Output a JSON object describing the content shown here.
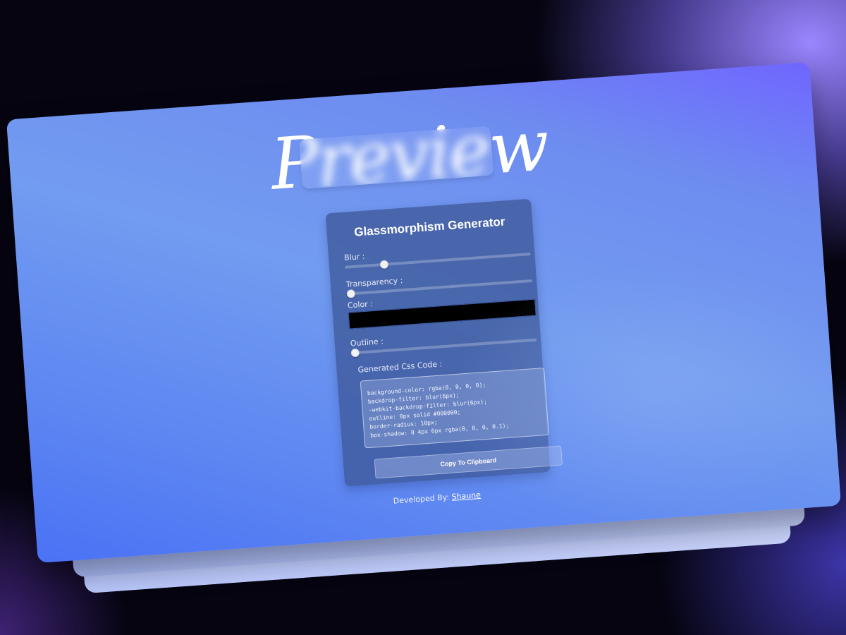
{
  "preview": {
    "text": "Preview"
  },
  "generator": {
    "title": "Glassmorphism Generator",
    "blur": {
      "label": "Blur :",
      "value_fraction": 0.21
    },
    "transparency": {
      "label": "Transparency :",
      "value_fraction": 0.0
    },
    "color": {
      "label": "Color :",
      "value": "#000000"
    },
    "outline": {
      "label": "Outline :",
      "value_fraction": 0.0
    },
    "code_label": "Generated Css Code :",
    "code_lines": [
      "background-color: rgba(0, 0, 0, 0);",
      "backdrop-filter: blur(6px);",
      "-webkit-backdrop-filter: blur(6px);",
      "outline: 0px solid #000000;",
      "border-radius: 10px;",
      "box-shadow: 0 4px 6px rgba(0, 0, 0, 0.1);"
    ],
    "copy_button": "Copy To Clipboard"
  },
  "footer": {
    "prefix": "Developed By:",
    "author": "Shaune"
  },
  "colors": {
    "card_gradient_start": "#6f66ff",
    "card_gradient_end": "#4a72f5",
    "panel_bg": "#3c5596",
    "background": "#050410"
  }
}
